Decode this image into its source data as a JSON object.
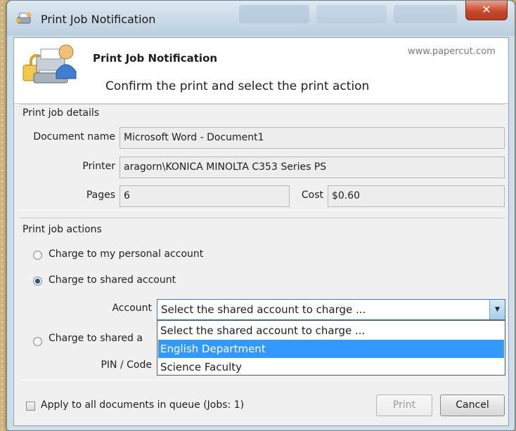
{
  "window": {
    "title": "Print Job Notification",
    "close_glyph": "✕"
  },
  "header": {
    "title": "Print Job Notification",
    "subtitle": "Confirm the print and select the print action",
    "url": "www.papercut.com"
  },
  "details": {
    "group_label": "Print job details",
    "document_name_label": "Document name",
    "document_name": "Microsoft Word - Document1",
    "printer_label": "Printer",
    "printer": "aragorn\\KONICA MINOLTA C353 Series PS",
    "pages_label": "Pages",
    "pages": "6",
    "cost_label": "Cost",
    "cost": "$0.60"
  },
  "actions": {
    "group_label": "Print job actions",
    "options": [
      {
        "label": "Charge to my personal account",
        "selected": false
      },
      {
        "label": "Charge to shared account",
        "selected": true
      },
      {
        "label": "Charge to shared a",
        "selected": false
      }
    ],
    "account_label": "Account",
    "account_value": "Select the shared account to charge ...",
    "pin_label": "PIN / Code",
    "dropdown_items": [
      "Select the shared account to charge ...",
      "English Department",
      "Science Faculty"
    ],
    "dropdown_highlighted": "English Department"
  },
  "footer": {
    "apply_all_label": "Apply to all documents in queue (Jobs: 1)",
    "apply_all_checked": false,
    "print_label": "Print",
    "cancel_label": "Cancel"
  },
  "colors": {
    "selection": "#3399ff",
    "close_button": "#c8492c"
  },
  "icons": [
    "printer-user-icon",
    "close-icon",
    "dropdown-arrow-icon"
  ]
}
